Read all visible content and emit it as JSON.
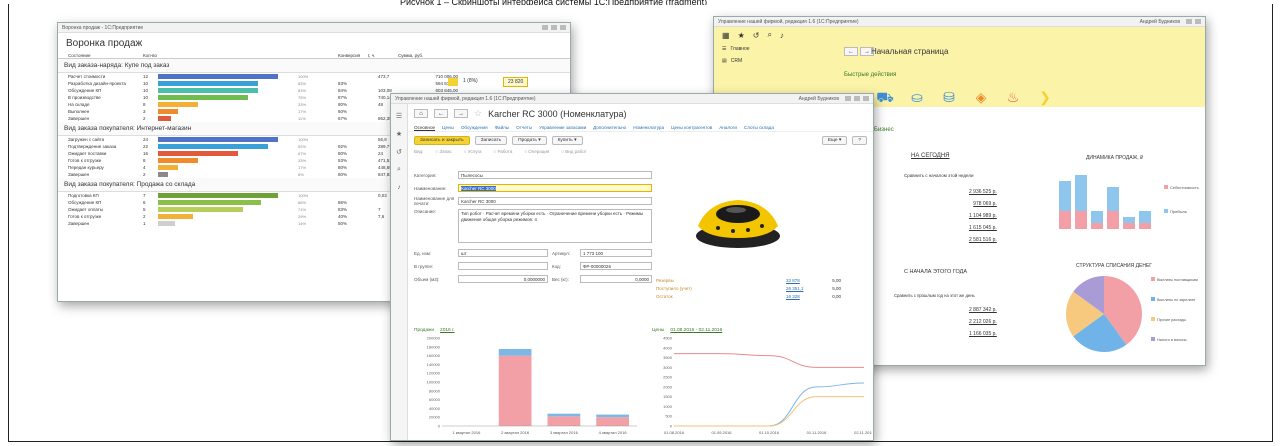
{
  "page_top_caption": "Рисунок 1 – Скриншоты интерфейса системы 1С:Предприятие (fragment)",
  "left_window": {
    "titlebar": "Воронка продаж - 1С:Предприятие",
    "title": "Воронка продаж",
    "columns": [
      "Состояние",
      "Кол-во",
      "",
      "",
      "Конверсия",
      "t, ч.",
      "Сумма, руб.",
      "",
      "Остаток",
      "Сумма, руб."
    ],
    "groups": [
      {
        "name": "Вид заказа-наряда: Купе под заказ",
        "rows": [
          {
            "name": "Расчет стоимости",
            "count": "12",
            "pct": 100,
            "pct_label": "100%",
            "conv": "",
            "t": "473,7",
            "sum": "710 006,00",
            "color": "#4e73c9"
          },
          {
            "name": "Разработка дизайн-проекта",
            "count": "10",
            "pct": 83,
            "pct_label": "83%",
            "conv": "83%",
            "t": "",
            "sum": "594 571,00",
            "color": "#3aa0d8"
          },
          {
            "name": "Обсуждение КП",
            "count": "10",
            "pct": 83,
            "pct_label": "83%",
            "conv": "84%",
            "t": "103,08",
            "sum": "603 845,00",
            "color": "#4cbfa9"
          },
          {
            "name": "В производстве",
            "count": "10",
            "pct": 75,
            "pct_label": "75%",
            "conv": "87%",
            "t": "740,14",
            "sum": "577 420,00",
            "color": "#6fbd4f"
          },
          {
            "name": "На складе",
            "count": "8",
            "pct": 33,
            "pct_label": "33%",
            "conv": "80%",
            "t": "48",
            "sum": "499 020,00",
            "color": "#f2b134"
          },
          {
            "name": "Выполнен",
            "count": "3",
            "pct": 17,
            "pct_label": "17%",
            "conv": "60%",
            "t": "",
            "sum": "218 025,00",
            "color": "#f08a2c"
          },
          {
            "name": "Завершен",
            "count": "2",
            "pct": 11,
            "pct_label": "11%",
            "conv": "67%",
            "t": "862,35",
            "sum": "123 000,00",
            "color": "#e25a3a"
          }
        ]
      },
      {
        "name": "Вид заказа покупателя: Интернет-магазин",
        "rows": [
          {
            "name": "Загружен с сайта",
            "count": "24",
            "pct": 100,
            "pct_label": "100%",
            "conv": "",
            "t": "56,8",
            "sum": "613 277,00",
            "color": "#4e73c9"
          },
          {
            "name": "Подтверждение заказа",
            "count": "22",
            "pct": 92,
            "pct_label": "92%",
            "conv": "92%",
            "t": "289,77",
            "sum": "609 141,00",
            "color": "#3aa0d8"
          },
          {
            "name": "Ожидает поставки",
            "count": "16",
            "pct": 67,
            "pct_label": "67%",
            "conv": "80%",
            "t": "24",
            "sum": "519 683,00",
            "color": "#e25a3a"
          },
          {
            "name": "Готов к отгрузке",
            "count": "8",
            "pct": 33,
            "pct_label": "33%",
            "conv": "53%",
            "t": "471,51",
            "sum": "132 546,00",
            "color": "#f08a2c"
          },
          {
            "name": "Передан курьеру",
            "count": "4",
            "pct": 17,
            "pct_label": "17%",
            "conv": "80%",
            "t": "448,65",
            "sum": "82 041,00",
            "color": "#f2b134"
          },
          {
            "name": "Завершен",
            "count": "2",
            "pct": 8,
            "pct_label": "8%",
            "conv": "80%",
            "t": "847,82",
            "sum": "44 738,00",
            "color": "#8a8a8a"
          }
        ]
      },
      {
        "name": "Вид заказа покупателя: Продажа со склада",
        "rows": [
          {
            "name": "Подготовка КП",
            "count": "7",
            "pct": 100,
            "pct_label": "100%",
            "conv": "",
            "t": "0,03",
            "sum": "121 971,40",
            "color": "#6fa33a"
          },
          {
            "name": "Обсуждение КП",
            "count": "6",
            "pct": 86,
            "pct_label": "86%",
            "conv": "86%",
            "t": "",
            "sum": "102 827,00",
            "color": "#8bbf4a"
          },
          {
            "name": "Ожидает оплаты",
            "count": "5",
            "pct": 71,
            "pct_label": "71%",
            "conv": "83%",
            "t": "7",
            "sum": "95 782,00",
            "color": "#b5cf5a"
          },
          {
            "name": "Готов к отгрузке",
            "count": "2",
            "pct": 29,
            "pct_label": "29%",
            "conv": "40%",
            "t": "7,6",
            "sum": "48 874,40",
            "color": "#f2b134"
          },
          {
            "name": "Завершен",
            "count": "1",
            "pct": 14,
            "pct_label": "14%",
            "conv": "50%",
            "t": "",
            "sum": "14 805,40",
            "color": "#cfcfcf"
          }
        ]
      }
    ],
    "remain": {
      "pct": "1 (8%)",
      "sum": "23 820"
    }
  },
  "right_window": {
    "titlebar": "Управление нашей фирмой, редакция 1.6 (1С:Предприятие)",
    "user": "Андрей Будников",
    "sidebar": [
      "Главное",
      "CRM"
    ],
    "page_title": "Начальная страница",
    "quick_actions": "Быстрые действия",
    "business": "Бизнес",
    "today_title": "НА СЕГОДНЯ",
    "today_link": "Сравнить с началом этой недели",
    "today_values": [
      "2 936 525 р.",
      "978 069 р.",
      "1 104 989 р.",
      "1 615 045 р.",
      "2 581 516 р."
    ],
    "year_title": "С НАЧАЛА ЭТОГО ГОДА",
    "year_link": "Сравнить с прошлым год на этот же день",
    "year_values": [
      "2 887 342 р.",
      "2 212 026 р.",
      "1 166 035 р."
    ],
    "sales_chart_title": "ДИНАМИКА ПРОДАЖ, ₽",
    "sales_legend": [
      "Себестоимость",
      "Прибыль"
    ],
    "pie_title": "СТРУКТУРА СПИСАНИЯ ДЕНЕГ",
    "pie_legend": [
      "Выплаты поставщикам",
      "Выплаты по зарплате",
      "Прочие расходы",
      "Налоги и взносы"
    ]
  },
  "front_window": {
    "titlebar": "Управление нашей фирмой, редакция 1.6 (1С:Предприятие)",
    "user": "Андрей Будников",
    "title": "Karcher RC 3000 (Номенклатура)",
    "tabs": [
      "Основное",
      "Цены",
      "Обсуждения",
      "Файлы",
      "Отчеты",
      "Управление запасами",
      "Дополнительно",
      "Номенклатура",
      "Цены контрагентов",
      "Аналоги",
      "Слоты склада"
    ],
    "btn_save_close": "Записать и закрыть",
    "btn_save": "Записать",
    "btn_sell": "Продать ▾",
    "btn_buy": "Купить ▾",
    "btn_more": "Еще ▾",
    "btn_help": "?",
    "type_label": "Вид:",
    "types": [
      "Запас",
      "Услуга",
      "Работа",
      "Операция",
      "Вид работ"
    ],
    "fields": {
      "category_label": "Категория:",
      "category": "Пылесосы",
      "name_label": "Наименование:",
      "name": "Karcher RC 3000",
      "fullname_label": "Наименование для печати:",
      "fullname": "Karcher RC 3000",
      "desc_label": "Описание:",
      "desc": "Тип робот · Расчет времени уборки есть · Ограничение времени уборки есть · Режимы движения общая уборка режимов: 4",
      "unit_label": "Ед. изм:",
      "unit": "шт",
      "article_label": "Артикул:",
      "article": "1 773 100",
      "group_label": "В группе:",
      "group": "",
      "code_label": "Код:",
      "code": "ФР-00000026",
      "volume_label": "Объем (м3):",
      "volume": "0,0000000",
      "weight_label": "Вес (кг):",
      "weight": "0,0000"
    },
    "stats": [
      {
        "label": "Резервы",
        "value": "33 878",
        "extra": "5,00"
      },
      {
        "label": "Поступило (учет)",
        "value": "26 351,1",
        "extra": "5,00"
      },
      {
        "label": "Остаток",
        "value": "16 328",
        "extra": "0,00"
      }
    ],
    "sales_hdr": "Продажи",
    "sales_year": "2016 г.",
    "prices_hdr": "Цены",
    "prices_period": "01.08.2016 - 02.11.2016"
  },
  "chart_data": [
    {
      "type": "bar",
      "categories": [
        "1 квартал 2016",
        "2 квартал 2016",
        "3 квартал 2016",
        "4 квартал 2016"
      ],
      "series": [
        {
          "values": [
            0,
            160000,
            22000,
            20000
          ]
        },
        {
          "values": [
            0,
            15000,
            6000,
            6000
          ]
        }
      ],
      "ylim": [
        0,
        200000
      ],
      "yticks": [
        "200000",
        "180000",
        "160000",
        "140000",
        "120000",
        "100000",
        "80000",
        "60000",
        "40000",
        "20000",
        "0"
      ]
    },
    {
      "type": "line",
      "x": [
        "01.08.2016",
        "01.09.2016",
        "01.10.2016",
        "01.11.2016",
        "02.11.2016"
      ],
      "series": [
        {
          "values": [
            3700,
            3700,
            3600,
            3000,
            3000
          ]
        },
        {
          "values": [
            0,
            0,
            0,
            2000,
            2200
          ]
        },
        {
          "values": [
            0,
            0,
            0,
            1500,
            1500
          ]
        }
      ],
      "ylim": [
        0,
        4500
      ],
      "yticks": [
        "4500",
        "4000",
        "3500",
        "3000",
        "2500",
        "2000",
        "1500",
        "1000",
        "500",
        "0"
      ]
    },
    {
      "type": "bar",
      "categories": [
        "1",
        "2",
        "3",
        "4",
        "5",
        "6"
      ],
      "series": [
        {
          "name": "Себестоимость",
          "values": [
            5,
            6,
            2,
            4,
            1,
            2
          ]
        },
        {
          "name": "Прибыль",
          "values": [
            3,
            3,
            1,
            3,
            1,
            1
          ]
        }
      ]
    },
    {
      "type": "pie",
      "series": [
        {
          "values": [
            40,
            25,
            20,
            15
          ]
        }
      ],
      "labels": [
        "Выплаты поставщикам",
        "Выплаты по зарплате",
        "Прочие расходы",
        "Налоги и взносы"
      ]
    }
  ]
}
